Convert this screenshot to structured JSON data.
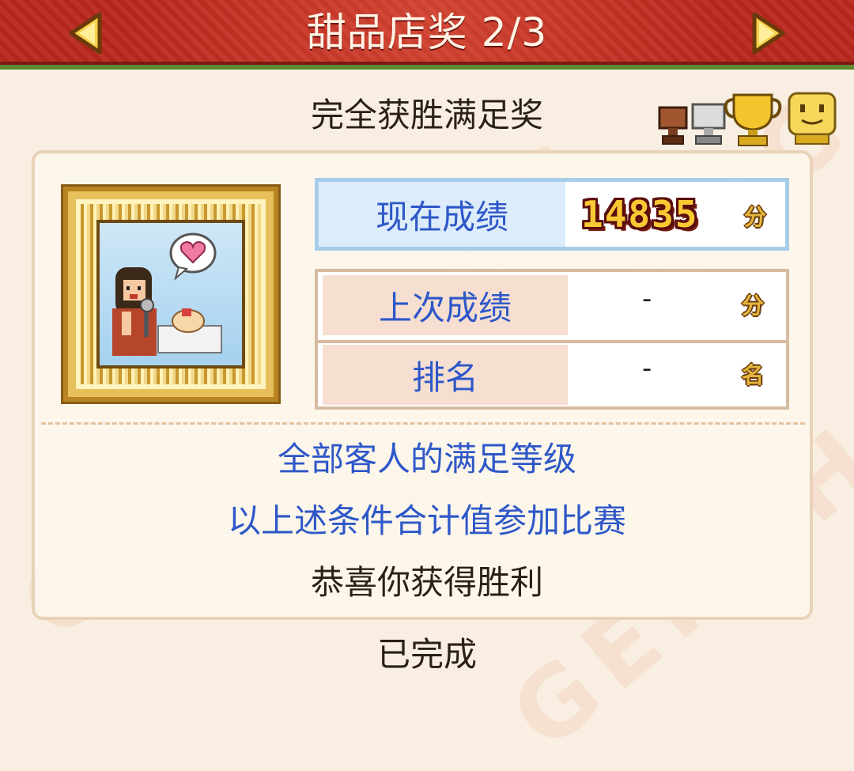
{
  "header": {
    "title": "甜品店奖 2/3",
    "prev_icon": "arrow-left-icon",
    "next_icon": "arrow-right-icon"
  },
  "award": {
    "name": "完全获胜满足奖",
    "trophy_icons": [
      "bronze-trophy-icon",
      "silver-trophy-icon",
      "gold-trophy-icon",
      "king-trophy-icon"
    ]
  },
  "stats": {
    "current": {
      "label": "现在成绩",
      "value": "14835",
      "unit": "分"
    },
    "previous": {
      "label": "上次成绩",
      "value": "-",
      "unit": "分"
    },
    "rank": {
      "label": "排名",
      "value": "-",
      "unit": "名"
    }
  },
  "description": {
    "line1": "全部客人的满足等级",
    "line2": "以上述条件合计值参加比赛",
    "line3": "恭喜你获得胜利"
  },
  "status": "已完成",
  "watermark": [
    "GEI CHANG",
    "GEI CHANG",
    "GEI CHANG"
  ],
  "colors": {
    "header_red": "#b9271c",
    "label_blue": "#2e57c8",
    "score_gold": "#f9c934"
  }
}
